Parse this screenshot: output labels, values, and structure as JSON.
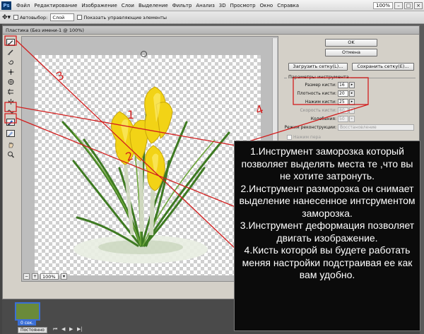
{
  "app": {
    "logo": "Ps",
    "zoom": "100%"
  },
  "menu": [
    "Файл",
    "Редактирование",
    "Изображение",
    "Слои",
    "Выделение",
    "Фильтр",
    "Анализ",
    "3D",
    "Просмотр",
    "Окно",
    "Справка"
  ],
  "options": {
    "autoselect_label": "Автовыбор:",
    "autoselect_value": "Слой",
    "show_controls_label": "Показать управляющие элементы"
  },
  "dialog": {
    "title": "Пластика (Без имени-1 @ 100%)",
    "zoom_value": "100%",
    "buttons": {
      "ok": "OK",
      "cancel": "Отмена",
      "load_mesh": "Загрузить сетку(L)...",
      "save_mesh": "Сохранить сетку(E)..."
    },
    "params": {
      "group_title": "Параметры инструмента",
      "brush_size_label": "Размер кисти:",
      "brush_size_value": "16",
      "brush_density_label": "Плотность кисти:",
      "brush_density_value": "20",
      "brush_pressure_label": "Нажим кисти:",
      "brush_pressure_value": "25",
      "brush_rate_label": "Скорость кисти:",
      "brush_rate_value": "80",
      "turbulence_label": "Колебания:",
      "turbulence_value": "50",
      "recon_mode_label": "Режим реконструкции:",
      "recon_mode_value": "Восстановление",
      "stylus_label": "Нажим пера"
    }
  },
  "animation": {
    "frame_time": "0 сек.",
    "loop": "Постоянно"
  },
  "annotations": {
    "num1": "1",
    "num2": "2",
    "num3": "3",
    "num4": "4",
    "text": [
      "1.Инструмент заморозка который позволяет выделять места те ,что вы не хотите затронуть.",
      "2.Инструмент разморозка он снимает выделение нанесенное интсрументом заморозка.",
      "3.Инструмент деформация позволяет двигать изображение.",
      "4.Кисть которой вы будете работать меняя настройки подстраивая ее как вам удобно."
    ],
    "line_color": "#d21e1e"
  }
}
